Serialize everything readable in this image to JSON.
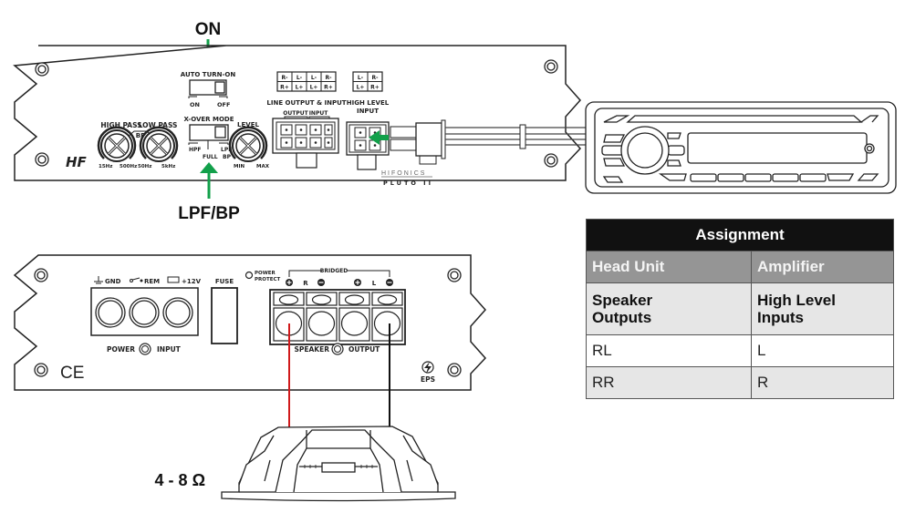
{
  "annotations": {
    "on_label": "ON",
    "lpf_bp_label": "LPF/BP",
    "impedance_label": "4 - 8 Ω",
    "arrow_color": "#12a04a"
  },
  "top_panel": {
    "auto_turn_on": {
      "title": "AUTO TURN-ON",
      "left": "ON",
      "right": "OFF"
    },
    "xover_mode": {
      "title": "X-OVER MODE",
      "left": "HPF",
      "middle": "FULL",
      "right_top": "LPF",
      "right_bottom": "BP"
    },
    "high_pass": {
      "title": "HIGH PASS",
      "min": "15Hz",
      "max": "500Hz"
    },
    "low_pass": {
      "title": "LOW PASS",
      "min": "50Hz",
      "max": "5kHz"
    },
    "bp_label": "BP",
    "level": {
      "title": "LEVEL",
      "min": "MIN",
      "max": "MAX"
    },
    "line_io": {
      "title": "LINE OUTPUT & INPUT",
      "output_label": "OUTPUT",
      "input_label": "INPUT",
      "pins_top": [
        "R-",
        "L-",
        "L-",
        "R-"
      ],
      "pins_bottom": [
        "R+",
        "L+",
        "L+",
        "R+"
      ]
    },
    "high_level_input": {
      "title_line1": "HIGH LEVEL",
      "title_line2": "INPUT",
      "pins_top": [
        "L-",
        "R-"
      ],
      "pins_bottom": [
        "L+",
        "R+"
      ]
    },
    "brand_line1": "HIFONICS",
    "brand_line2": "PLUTO II",
    "logo": "HF"
  },
  "bottom_panel": {
    "gnd": "GND",
    "rem": "REM",
    "plus12v": "+12V",
    "fuse": "FUSE",
    "power_protect_1": "POWER",
    "power_protect_2": "PROTECT",
    "power_input_left": "POWER",
    "power_input_right": "INPUT",
    "bridged": "BRIDGED",
    "speaker_r": "R",
    "speaker_l": "L",
    "speaker_output_left": "SPEAKER",
    "speaker_output_right": "OUTPUT",
    "eps": "EPS",
    "ce": "CE"
  },
  "table": {
    "title": "Assignment",
    "headers": [
      "Head Unit",
      "Amplifier"
    ],
    "subheader": [
      "Speaker Outputs",
      "High Level Inputs"
    ],
    "rows": [
      [
        "RL",
        "L"
      ],
      [
        "RR",
        "R"
      ]
    ]
  }
}
